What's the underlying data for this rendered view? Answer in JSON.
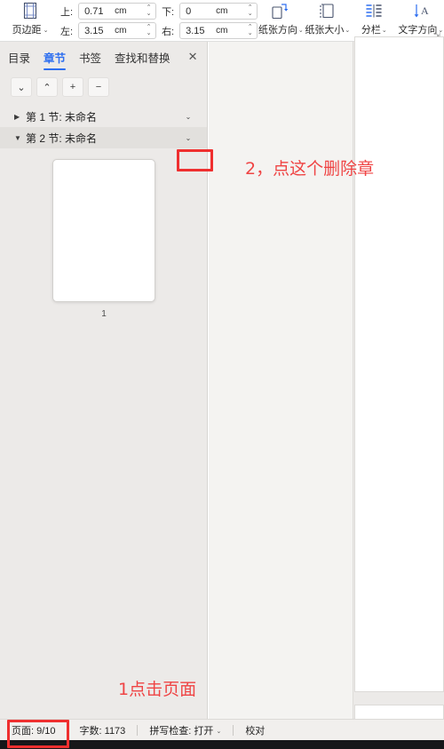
{
  "ribbon": {
    "margins": {
      "icon": "page-margins-icon",
      "label": "页边距",
      "caret": "⌄"
    },
    "fields": [
      {
        "name": "top",
        "label": "上:",
        "value": "0.71",
        "unit": "cm"
      },
      {
        "name": "bottom",
        "label": "下:",
        "value": "0",
        "unit": "cm"
      },
      {
        "name": "left",
        "label": "左:",
        "value": "3.15",
        "unit": "cm"
      },
      {
        "name": "right",
        "label": "右:",
        "value": "3.15",
        "unit": "cm"
      }
    ],
    "buttons": [
      {
        "name": "orientation",
        "icon": "page-orientation-icon",
        "label": "纸张方向",
        "caret": "⌄"
      },
      {
        "name": "size",
        "icon": "paper-size-icon",
        "label": "纸张大小",
        "caret": "⌄"
      },
      {
        "name": "columns",
        "icon": "columns-icon",
        "label": "分栏",
        "caret": "⌄"
      },
      {
        "name": "text-dir",
        "icon": "text-direction-icon",
        "label": "文字方向",
        "caret": "⌄"
      }
    ],
    "dialog_launcher": "⇲"
  },
  "navpane": {
    "tabs": [
      {
        "label": "目录",
        "active": false
      },
      {
        "label": "章节",
        "active": true
      },
      {
        "label": "书签",
        "active": false
      },
      {
        "label": "查找和替换",
        "active": false
      }
    ],
    "close_label": "✕",
    "toolbar": [
      {
        "name": "next-section",
        "glyph": "⌄"
      },
      {
        "name": "prev-section",
        "glyph": "⌃"
      },
      {
        "name": "add-section",
        "glyph": "+"
      },
      {
        "name": "remove-section",
        "glyph": "−"
      }
    ],
    "tree": [
      {
        "twisty": "▶",
        "label": "第 1 节: 未命名",
        "caret": "⌄",
        "selected": false
      },
      {
        "twisty": "▼",
        "label": "第 2 节: 未命名",
        "caret": "⌄",
        "selected": true
      }
    ],
    "thumbnail": {
      "page_number": "1"
    }
  },
  "statusbar": {
    "page": "页面: 9/10",
    "words": "字数: 1173",
    "spellcheck": "拼写检查: 打开",
    "spellcheck_caret": "⌄",
    "proofread": "校对"
  },
  "annotations": [
    {
      "name": "step-2-note",
      "text": "2，点这个删除章"
    },
    {
      "name": "step-1-note",
      "text": "1点击页面"
    }
  ],
  "colors": {
    "accent": "#2d6ef0",
    "annotation": "#ef4444",
    "annotation_box": "#ef2f2f",
    "panel_bg": "#eceae8"
  }
}
